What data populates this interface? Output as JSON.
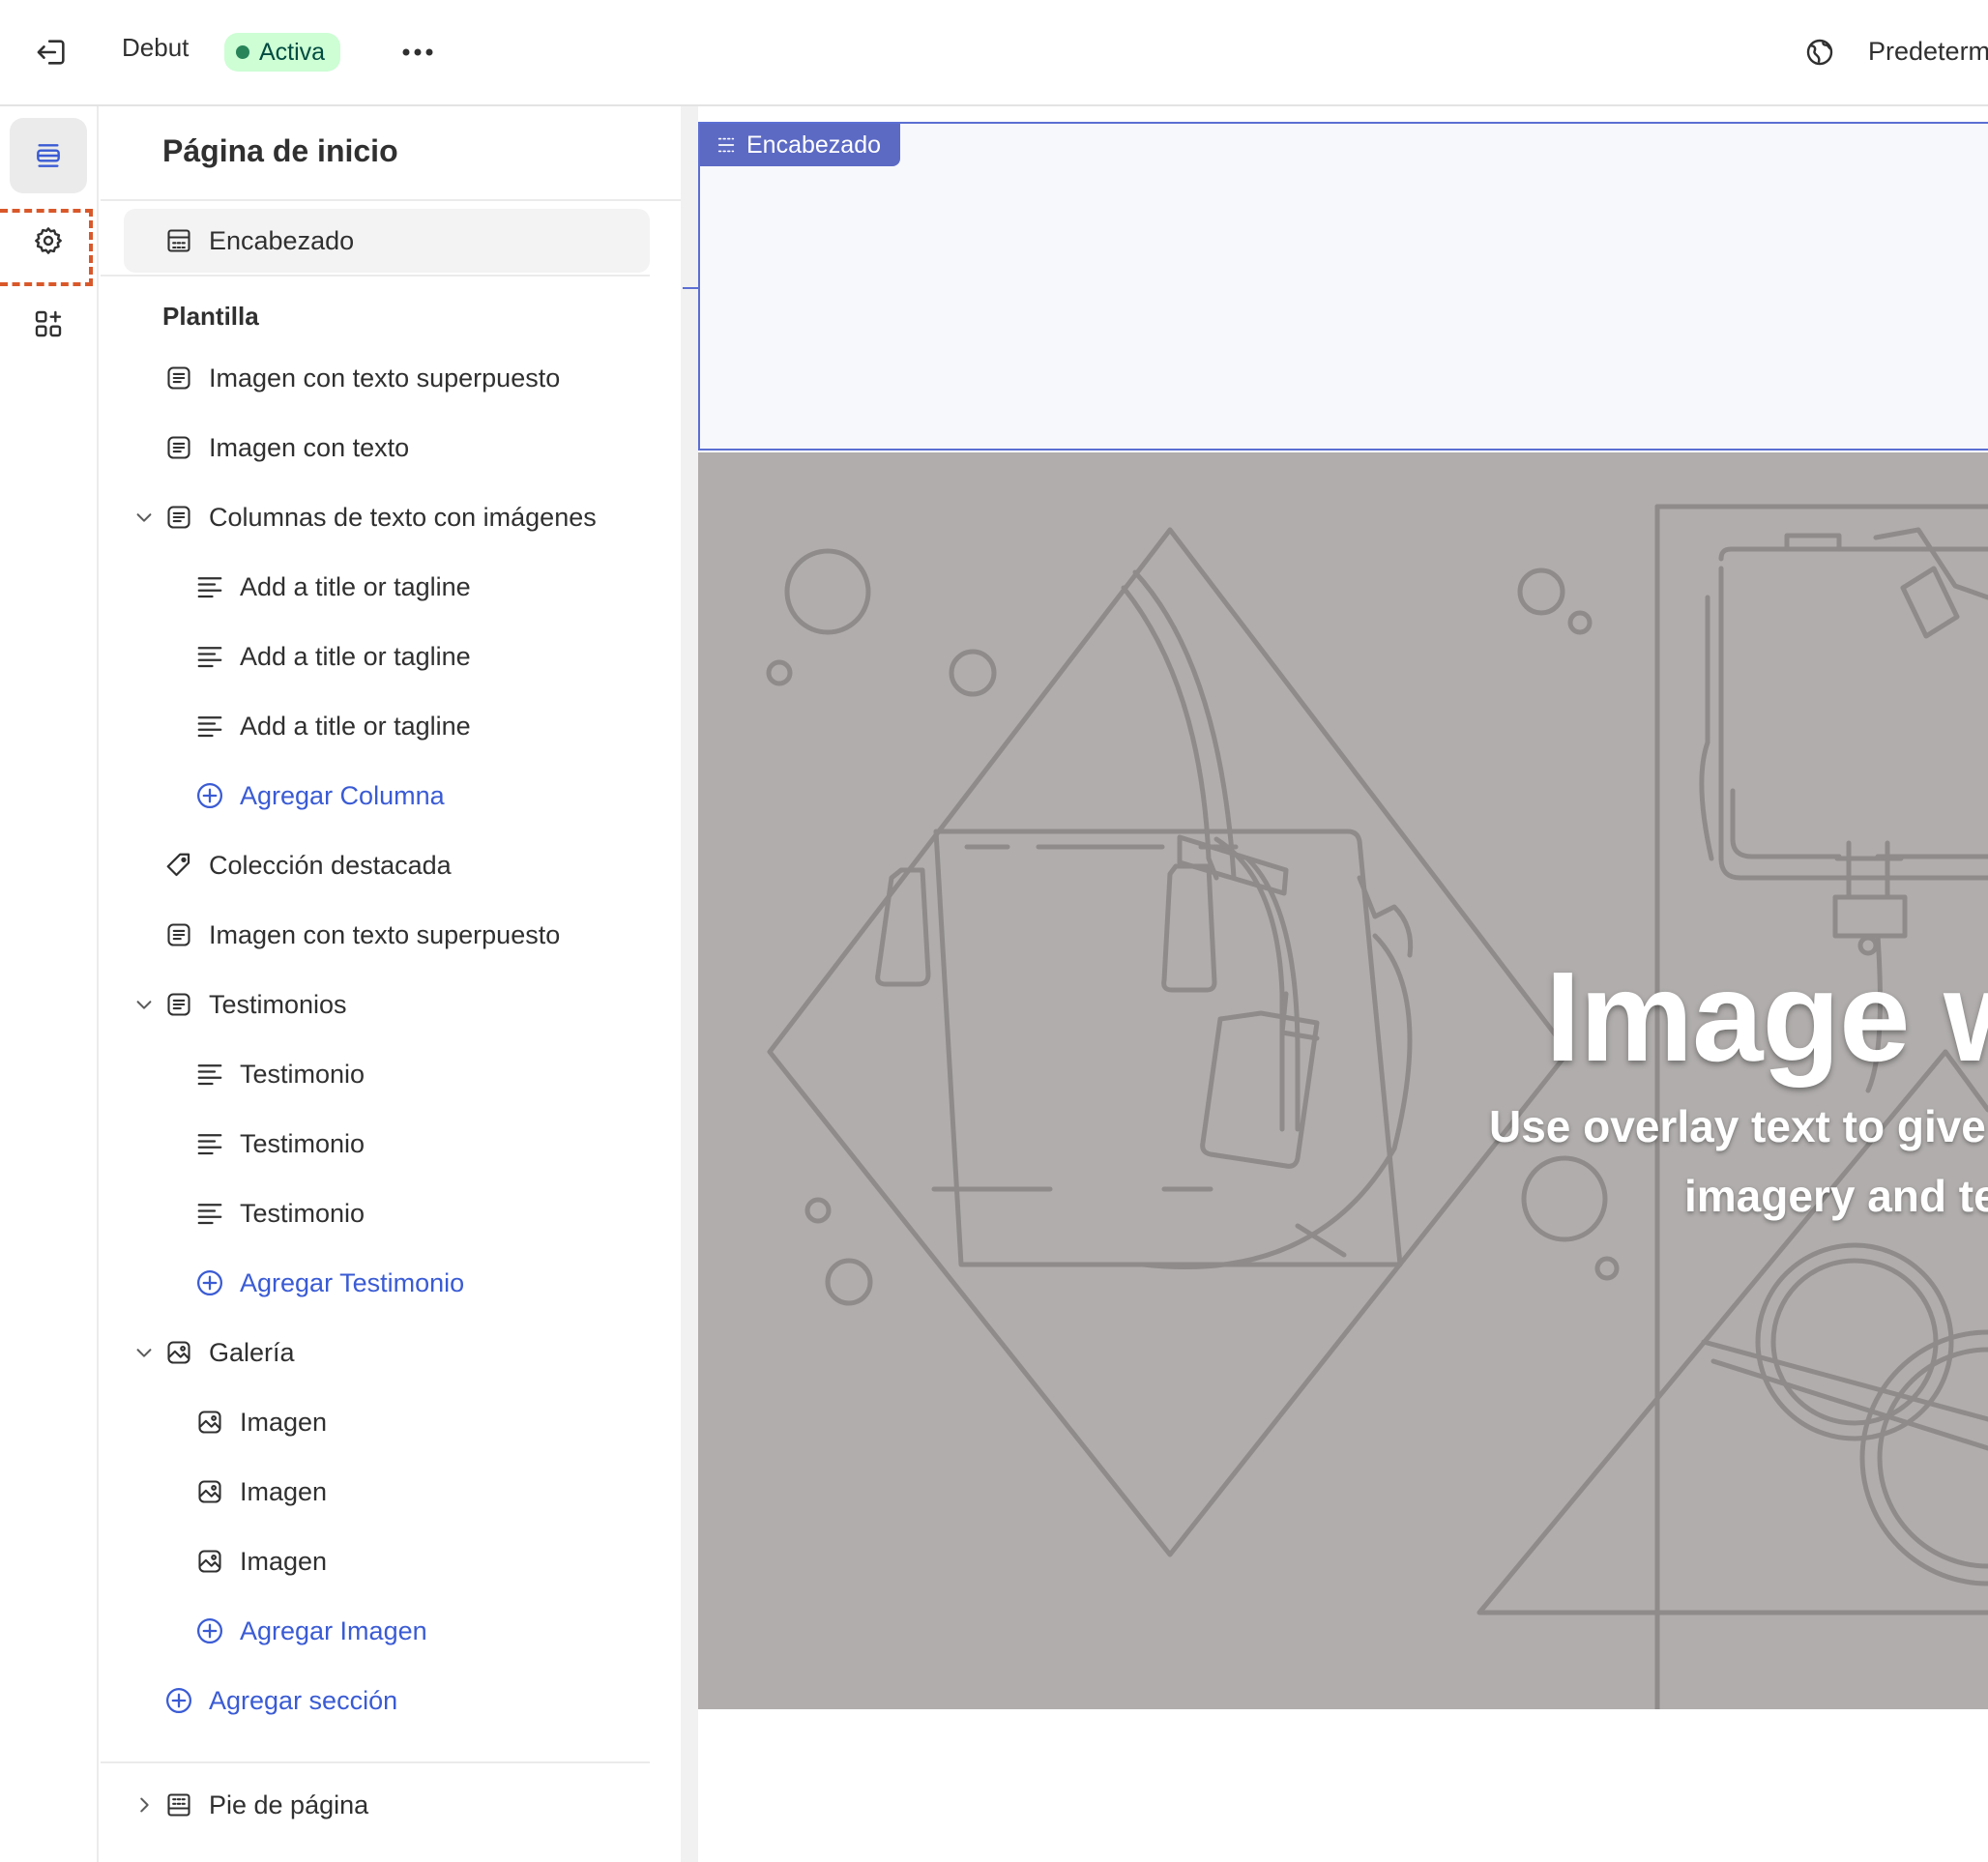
{
  "topbar": {
    "theme_name": "Debut",
    "status_badge": "Activa",
    "locale_label": "Predeterm"
  },
  "sidebar": {
    "title": "Página de inicio",
    "header_item": "Encabezado",
    "template_label": "Plantilla",
    "items": [
      {
        "label": "Imagen con texto superpuesto",
        "icon": "section-icon",
        "level": 0
      },
      {
        "label": "Imagen con texto",
        "icon": "section-icon",
        "level": 0
      },
      {
        "label": "Columnas de texto con imágenes",
        "icon": "section-icon",
        "level": 0,
        "expanded": true
      },
      {
        "label": "Add a title or tagline",
        "icon": "text-block-icon",
        "level": 1
      },
      {
        "label": "Add a title or tagline",
        "icon": "text-block-icon",
        "level": 1
      },
      {
        "label": "Add a title or tagline",
        "icon": "text-block-icon",
        "level": 1
      },
      {
        "label": "Agregar Columna",
        "icon": "add-circle-icon",
        "level": 1,
        "link": true
      },
      {
        "label": "Colección destacada",
        "icon": "tag-icon",
        "level": 0
      },
      {
        "label": "Imagen con texto superpuesto",
        "icon": "section-icon",
        "level": 0
      },
      {
        "label": "Testimonios",
        "icon": "section-icon",
        "level": 0,
        "expanded": true
      },
      {
        "label": "Testimonio",
        "icon": "text-block-icon",
        "level": 1
      },
      {
        "label": "Testimonio",
        "icon": "text-block-icon",
        "level": 1
      },
      {
        "label": "Testimonio",
        "icon": "text-block-icon",
        "level": 1
      },
      {
        "label": "Agregar Testimonio",
        "icon": "add-circle-icon",
        "level": 1,
        "link": true
      },
      {
        "label": "Galería",
        "icon": "image-icon",
        "level": 0,
        "expanded": true
      },
      {
        "label": "Imagen",
        "icon": "image-icon",
        "level": 1
      },
      {
        "label": "Imagen",
        "icon": "image-icon",
        "level": 1
      },
      {
        "label": "Imagen",
        "icon": "image-icon",
        "level": 1
      },
      {
        "label": "Agregar Imagen",
        "icon": "add-circle-icon",
        "level": 1,
        "link": true
      },
      {
        "label": "Agregar sección",
        "icon": "add-circle-icon",
        "level": 0,
        "link": true
      }
    ],
    "footer_item": "Pie de página"
  },
  "preview": {
    "header_tag": "Encabezado",
    "hero_title": "Image w",
    "hero_subtitle_line1": "Use overlay text to give",
    "hero_subtitle_line2": "imagery and te"
  },
  "colors": {
    "accent_link": "#3a5bd4",
    "badge_bg": "#cdfed4",
    "badge_dot": "#29845a",
    "selection_outline": "#5b6fd3",
    "highlight_dashed": "#d9582a",
    "hero_bg": "#b0adac"
  }
}
